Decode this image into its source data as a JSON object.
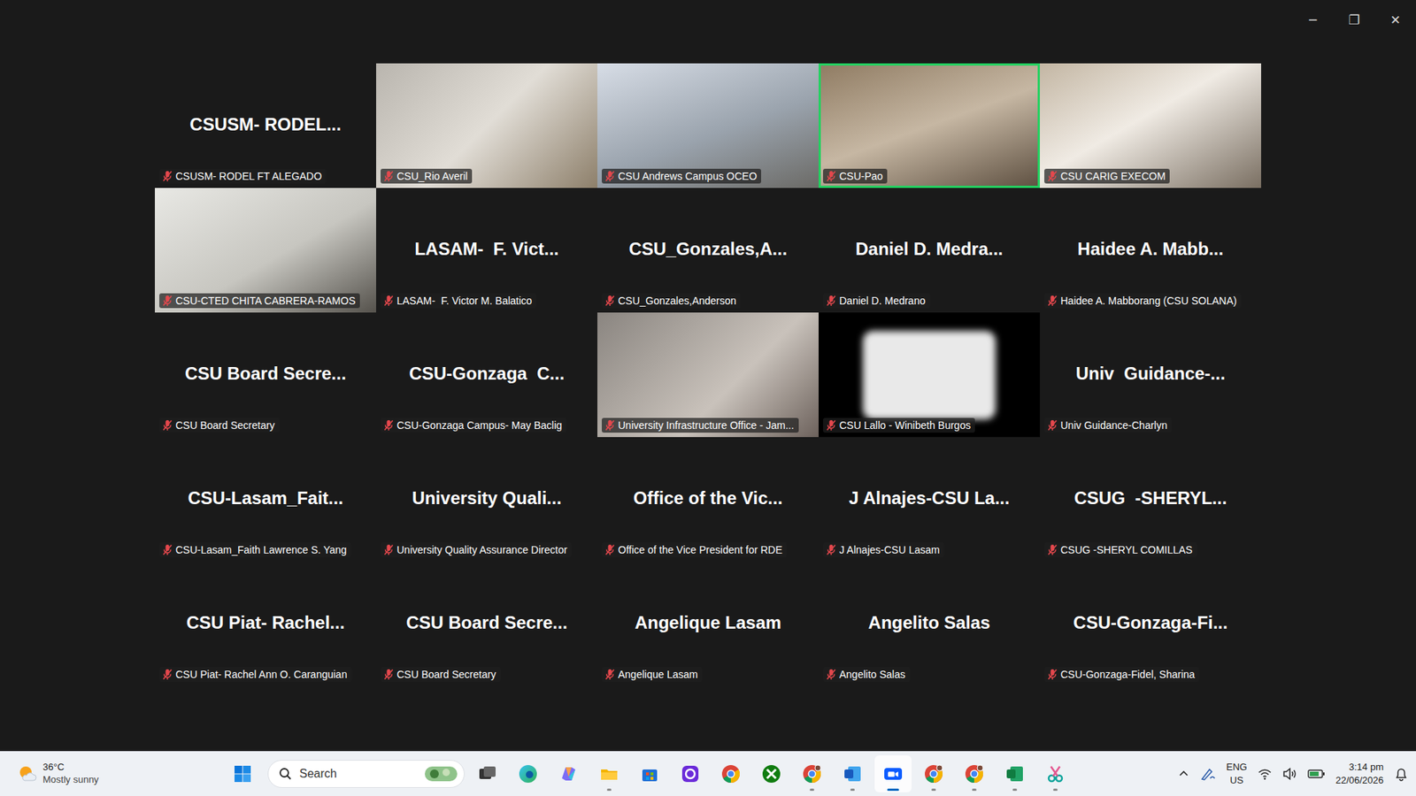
{
  "window": {
    "controls": [
      "─",
      "❐",
      "✕"
    ]
  },
  "gallery": {
    "tiles": [
      {
        "kind": "name",
        "name": "CSUSM- RODEL...",
        "label": "CSUSM- RODEL FT ALEGADO",
        "muted": true,
        "speaking": false
      },
      {
        "kind": "video",
        "label": "CSU_Rio Averil",
        "muted": true,
        "speaking": false
      },
      {
        "kind": "video",
        "label": "CSU Andrews Campus OCEO",
        "muted": true,
        "speaking": false
      },
      {
        "kind": "video",
        "label": "CSU-Pao",
        "muted": true,
        "speaking": true
      },
      {
        "kind": "video",
        "label": "CSU CARIG EXECOM",
        "muted": true,
        "speaking": false
      },
      {
        "kind": "video",
        "label": "CSU-CTED CHITA CABRERA-RAMOS",
        "muted": true,
        "speaking": false
      },
      {
        "kind": "name",
        "name": "LASAM-  F. Vict...",
        "label": "LASAM-  F. Victor M. Balatico",
        "muted": true,
        "speaking": false
      },
      {
        "kind": "name",
        "name": "CSU_Gonzales,A...",
        "label": "CSU_Gonzales,Anderson",
        "muted": true,
        "speaking": false
      },
      {
        "kind": "name",
        "name": "Daniel D. Medra...",
        "label": "Daniel D. Medrano",
        "muted": true,
        "speaking": false
      },
      {
        "kind": "name",
        "name": "Haidee A. Mabb...",
        "label": "Haidee A. Mabborang (CSU SOLANA)",
        "muted": true,
        "speaking": false
      },
      {
        "kind": "name",
        "name": "CSU Board Secre...",
        "label": "CSU Board Secretary",
        "muted": true,
        "speaking": false
      },
      {
        "kind": "name",
        "name": "CSU-Gonzaga  C...",
        "label": "CSU-Gonzaga Campus- May Baclig",
        "muted": true,
        "speaking": false
      },
      {
        "kind": "video",
        "label": "University Infrastructure Office - Jam...",
        "muted": true,
        "speaking": false
      },
      {
        "kind": "blurred",
        "label": "CSU Lallo - Winibeth Burgos",
        "muted": true,
        "speaking": false
      },
      {
        "kind": "name",
        "name": "Univ  Guidance-...",
        "label": "Univ Guidance-Charlyn",
        "muted": true,
        "speaking": false
      },
      {
        "kind": "name",
        "name": "CSU-Lasam_Fait...",
        "label": "CSU-Lasam_Faith Lawrence S. Yang",
        "muted": true,
        "speaking": false
      },
      {
        "kind": "name",
        "name": "University Quali...",
        "label": "University Quality Assurance Director",
        "muted": true,
        "speaking": false
      },
      {
        "kind": "name",
        "name": "Office of the Vic...",
        "label": "Office of the Vice President for RDE",
        "muted": true,
        "speaking": false
      },
      {
        "kind": "name",
        "name": "J Alnajes-CSU La...",
        "label": "J Alnajes-CSU Lasam",
        "muted": true,
        "speaking": false
      },
      {
        "kind": "name",
        "name": "CSUG  -SHERYL...",
        "label": "CSUG -SHERYL COMILLAS",
        "muted": true,
        "speaking": false
      },
      {
        "kind": "name",
        "name": "CSU Piat- Rachel...",
        "label": "CSU Piat- Rachel Ann O. Caranguian",
        "muted": true,
        "speaking": false
      },
      {
        "kind": "name",
        "name": "CSU Board Secre...",
        "label": "CSU Board Secretary",
        "muted": true,
        "speaking": false
      },
      {
        "kind": "name",
        "name": "Angelique Lasam",
        "label": "Angelique Lasam",
        "muted": true,
        "speaking": false
      },
      {
        "kind": "name",
        "name": "Angelito Salas",
        "label": "Angelito Salas",
        "muted": true,
        "speaking": false
      },
      {
        "kind": "name",
        "name": "CSU-Gonzaga-Fi...",
        "label": "CSU-Gonzaga-Fidel, Sharina",
        "muted": true,
        "speaking": false
      }
    ]
  },
  "taskbar": {
    "weather": {
      "temp": "36°C",
      "condition": "Mostly sunny"
    },
    "search": {
      "placeholder": "Search"
    },
    "apps": [
      {
        "kind": "taskview",
        "running": false,
        "active": false
      },
      {
        "kind": "edge",
        "running": false,
        "active": false
      },
      {
        "kind": "copilot",
        "running": false,
        "active": false
      },
      {
        "kind": "explorer",
        "running": true,
        "active": false
      },
      {
        "kind": "store",
        "running": false,
        "active": false
      },
      {
        "kind": "purple",
        "running": false,
        "active": false
      },
      {
        "kind": "chrome",
        "running": false,
        "active": false
      },
      {
        "kind": "xbox",
        "running": false,
        "active": false
      },
      {
        "kind": "chrome-profile",
        "running": true,
        "active": false
      },
      {
        "kind": "word",
        "running": true,
        "active": false
      },
      {
        "kind": "zoom",
        "running": true,
        "active": true
      },
      {
        "kind": "chrome-profile",
        "running": true,
        "active": false
      },
      {
        "kind": "chrome-profile",
        "running": true,
        "active": false
      },
      {
        "kind": "excel",
        "running": true,
        "active": false
      },
      {
        "kind": "snip",
        "running": true,
        "active": false
      }
    ],
    "tray": {
      "language": "ENG",
      "region": "US",
      "time": "3:14 pm",
      "date": "22/06/2026"
    }
  }
}
